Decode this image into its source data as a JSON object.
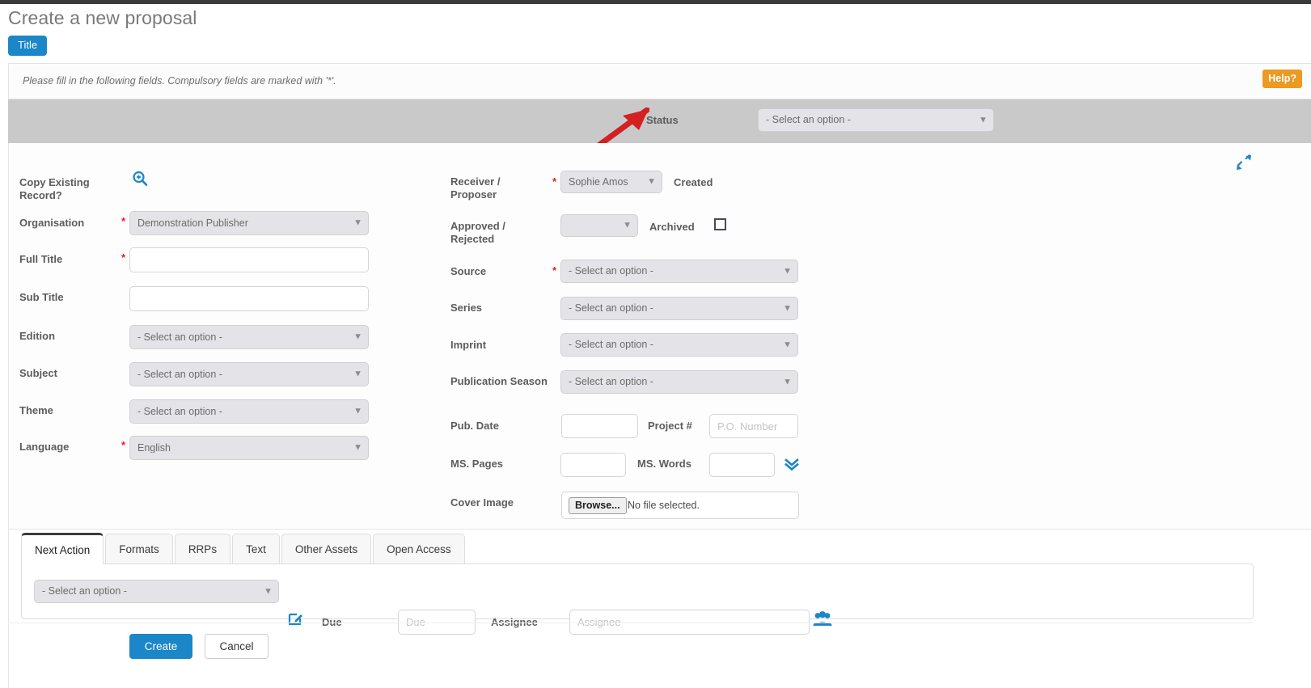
{
  "header": {
    "page_title": "Create a new proposal",
    "title_chip": "Title",
    "instruction": "Please fill in the following fields. Compulsory fields are marked with '*'.",
    "help_label": "Help?"
  },
  "status_band": {
    "label": "Status",
    "select_value": "- Select an option -"
  },
  "icons": {
    "collapse": "collapse-arrows-icon",
    "magnifier": "magnifier-plus-icon",
    "chevrons_down": "double-chevron-down-icon",
    "edit": "edit-pencil-icon",
    "people": "people-group-icon"
  },
  "placeholder_select": "- Select an option -",
  "left_column": [
    {
      "label": "Copy Existing Record?",
      "type": "icon-only",
      "required": false,
      "value": ""
    },
    {
      "label": "Organisation",
      "type": "select",
      "required": true,
      "value": "Demonstration Publisher"
    },
    {
      "label": "Full Title",
      "type": "text",
      "required": true,
      "value": ""
    },
    {
      "label": "Sub Title",
      "type": "text",
      "required": false,
      "value": ""
    },
    {
      "label": "Edition",
      "type": "select",
      "required": false,
      "value": "- Select an option -"
    },
    {
      "label": "Subject",
      "type": "select",
      "required": false,
      "value": "- Select an option -"
    },
    {
      "label": "Theme",
      "type": "select",
      "required": false,
      "value": "- Select an option -"
    },
    {
      "label": "Language",
      "type": "select",
      "required": true,
      "value": "English"
    }
  ],
  "right_column": {
    "receiver_label": "Receiver / Proposer",
    "receiver_value": "Sophie Amos",
    "created_label": "Created",
    "approved_label": "Approved / Rejected",
    "approved_value": "",
    "archived_label": "Archived",
    "source_label": "Source",
    "source_value": "- Select an option -",
    "series_label": "Series",
    "series_value": "- Select an option -",
    "imprint_label": "Imprint",
    "imprint_value": "- Select an option -",
    "pub_season_label": "Publication Season",
    "pub_season_value": "- Select an option -",
    "pub_date_label": "Pub. Date",
    "pub_date_value": "",
    "project_label": "Project #",
    "project_placeholder": "P.O. Number",
    "ms_pages_label": "MS. Pages",
    "ms_pages_value": "",
    "ms_words_label": "MS. Words",
    "ms_words_value": "",
    "cover_image_label": "Cover Image",
    "browse_label": "Browse...",
    "file_status": "No file selected."
  },
  "tabs": [
    {
      "label": "Next Action",
      "active": true
    },
    {
      "label": "Formats",
      "active": false
    },
    {
      "label": "RRPs",
      "active": false
    },
    {
      "label": "Text",
      "active": false
    },
    {
      "label": "Other Assets",
      "active": false
    },
    {
      "label": "Open Access",
      "active": false
    }
  ],
  "next_action_panel": {
    "action_select_value": "- Select an option -",
    "due_label": "Due",
    "due_placeholder": "Due",
    "assignee_label": "Assignee",
    "assignee_placeholder": "Assignee"
  },
  "footer": {
    "create_label": "Create",
    "cancel_label": "Cancel"
  },
  "colors": {
    "accent_blue": "#1b86c8",
    "help_orange": "#eb9a22",
    "required_red": "#e02020",
    "band_grey": "#c9c9c9",
    "arrow_red": "#d32020"
  }
}
